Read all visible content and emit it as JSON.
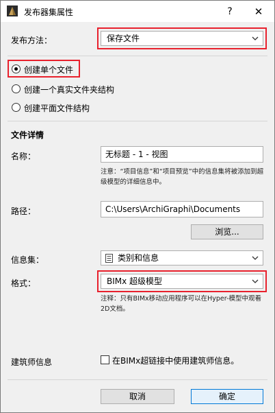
{
  "window": {
    "title": "发布器集属性",
    "help_symbol": "?",
    "close_symbol": "✕"
  },
  "publish_method": {
    "label": "发布方法：",
    "selected": "保存文件"
  },
  "structure_options": [
    {
      "label": "创建单个文件",
      "checked": true
    },
    {
      "label": "创建一个真实文件夹结构",
      "checked": false
    },
    {
      "label": "创建平面文件结构",
      "checked": false
    }
  ],
  "file_details": {
    "section_title": "文件详情",
    "name_label": "名称：",
    "name_value": "无标题 - 1 - 视图",
    "name_note": "注意：“项目信息”和“项目预览”中的信息集将被添加到超级模型的详细信息中。",
    "path_label": "路径：",
    "path_value": "C:\\Users\\ArchiGraphi\\Documents",
    "browse_label": "浏览...",
    "infoset_label": "信息集：",
    "infoset_value": "类别和信息",
    "format_label": "格式：",
    "format_value": "BIMx 超级模型",
    "format_note": "注释：只有BIMx移动应用程序可以在Hyper-模型中观看2D文档。",
    "architect_label": "建筑师信息",
    "architect_checkbox_label": "在BIMx超链接中使用建筑师信息。",
    "architect_checked": false
  },
  "footer": {
    "cancel_label": "取消",
    "ok_label": "确定"
  },
  "colors": {
    "highlight_red": "#e8202c",
    "primary_border": "#0078d7"
  }
}
